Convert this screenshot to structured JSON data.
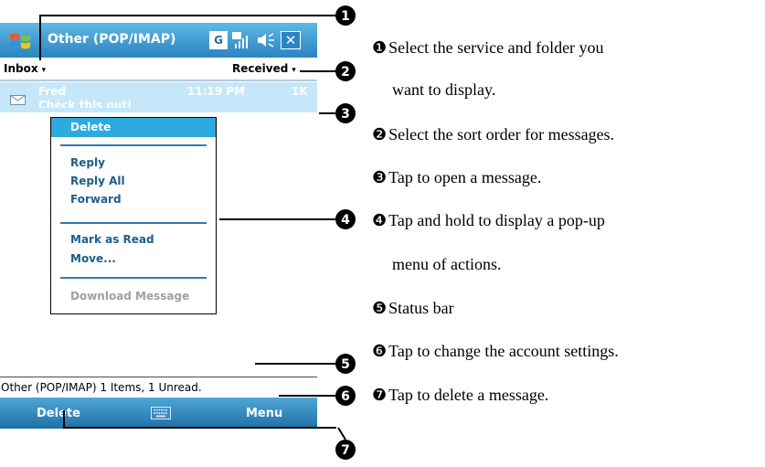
{
  "window": {
    "title": "Other (POP/IMAP)",
    "status_g_label": "G",
    "close_label": "✕"
  },
  "toolbar": {
    "folder_label": "Inbox",
    "sort_label": "Received",
    "caret": "▾"
  },
  "message": {
    "from": "Fred",
    "time": "11:19 PM",
    "size": "1K",
    "subject": "Check this out!"
  },
  "popup_menu": {
    "items": [
      "Delete",
      "Reply",
      "Reply All",
      "Forward",
      "Mark as Read",
      "Move...",
      "Download Message"
    ]
  },
  "status_bar": {
    "text": "Other (POP/IMAP)  1 Items, 1 Unread."
  },
  "softkeys": {
    "left": "Delete",
    "right": "Menu"
  },
  "callout_markers": [
    "❶",
    "❷",
    "❸",
    "❹",
    "❺",
    "❻",
    "❼"
  ],
  "legend": [
    {
      "num": "❶",
      "line1": "Select the service and folder you",
      "line2": "want to display."
    },
    {
      "num": "❷",
      "line1": "Select the sort order for messages."
    },
    {
      "num": "❸",
      "line1": "Tap to open a message."
    },
    {
      "num": "❹",
      "line1": "Tap and hold to display a pop-up",
      "line2": "menu of actions."
    },
    {
      "num": "❺",
      "line1": "Status bar"
    },
    {
      "num": "❻",
      "line1": "Tap to change the account settings."
    },
    {
      "num": "❼",
      "line1": "Tap to delete a message."
    }
  ],
  "colors": {
    "title_bar": "#2b83c2",
    "selection": "#c5e7f9",
    "menu_highlight": "#2daadf",
    "menu_text": "#1b5e8a"
  },
  "icons": [
    "windows-logo-icon",
    "network-g-icon",
    "signal-icon",
    "volume-icon",
    "close-icon",
    "envelope-icon",
    "keyboard-icon"
  ]
}
